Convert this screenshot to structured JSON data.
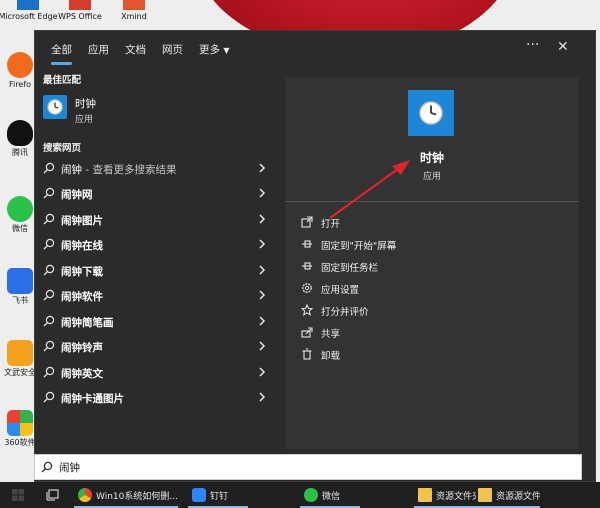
{
  "desktop": {
    "top_icons": [
      {
        "label": "Microsoft Edge",
        "icon": "edge-icon",
        "color": "#1a73c8"
      },
      {
        "label": "WPS Office",
        "icon": "wps-icon",
        "color": "#d83b2a"
      },
      {
        "label": "Xmind",
        "icon": "xmind-icon",
        "color": "#e3552f"
      }
    ],
    "side_icons": [
      {
        "label": "Firefo",
        "icon": "firefox-icon",
        "color": "#f26b1d"
      },
      {
        "label": "腾讯",
        "icon": "qq-icon",
        "color": "#111111"
      },
      {
        "label": "微信",
        "icon": "wechat-icon",
        "color": "#2bc24a"
      },
      {
        "label": "飞书",
        "icon": "feishu-icon",
        "color": "#2c6ee8"
      },
      {
        "label": "文武安全",
        "icon": "shield-app-icon",
        "color": "#f4a21b"
      },
      {
        "label": "360软件",
        "icon": "360-icon",
        "color": "#36b24a"
      }
    ]
  },
  "tabs": [
    {
      "label": "全部",
      "active": true
    },
    {
      "label": "应用"
    },
    {
      "label": "文档"
    },
    {
      "label": "网页"
    },
    {
      "label": "更多"
    }
  ],
  "header": {
    "more_label": "···",
    "close_label": "✕"
  },
  "best_match": {
    "heading": "最佳匹配",
    "name": "时钟",
    "type": "应用"
  },
  "web_search": {
    "heading": "搜索网页",
    "rows": [
      {
        "query": "闹钟",
        "hint": " - 查看更多搜索结果"
      },
      {
        "query": "闹钟网",
        "hint": ""
      },
      {
        "query": "闹钟图片",
        "hint": ""
      },
      {
        "query": "闹钟在线",
        "hint": ""
      },
      {
        "query": "闹钟下载",
        "hint": ""
      },
      {
        "query": "闹钟软件",
        "hint": ""
      },
      {
        "query": "闹钟简笔画",
        "hint": ""
      },
      {
        "query": "闹钟铃声",
        "hint": ""
      },
      {
        "query": "闹钟英文",
        "hint": ""
      },
      {
        "query": "闹钟卡通图片",
        "hint": ""
      }
    ]
  },
  "preview": {
    "title": "时钟",
    "subtitle": "应用",
    "actions": [
      {
        "label": "打开",
        "icon": "open-icon"
      },
      {
        "label": "固定到\"开始\"屏幕",
        "icon": "pin-start-icon"
      },
      {
        "label": "固定到任务栏",
        "icon": "pin-taskbar-icon"
      },
      {
        "label": "应用设置",
        "icon": "settings-icon"
      },
      {
        "label": "打分并评价",
        "icon": "star-icon"
      },
      {
        "label": "共享",
        "icon": "share-icon"
      },
      {
        "label": "卸载",
        "icon": "trash-icon"
      }
    ]
  },
  "search": {
    "value": "闹钟"
  },
  "taskbar": {
    "items": [
      {
        "label": "",
        "icon": "task-view-icon",
        "color": "#cfcfcf"
      },
      {
        "label": "Win10系统如何删...",
        "icon": "chrome-icon",
        "color": "#e94235"
      },
      {
        "label": "钉钉",
        "icon": "dingtalk-icon",
        "color": "#2f86f6"
      },
      {
        "label": "微信",
        "icon": "wechat-icon",
        "color": "#2bc24a"
      },
      {
        "label": "资源文件夹",
        "icon": "folder-icon",
        "color": "#f2c14e"
      },
      {
        "label": "资源源文件",
        "icon": "folder-icon",
        "color": "#f2c14e"
      }
    ]
  },
  "colors": {
    "accent": "#1e86d6",
    "tab_underline": "#5aa9e6",
    "annotation_arrow": "#e0242c"
  }
}
